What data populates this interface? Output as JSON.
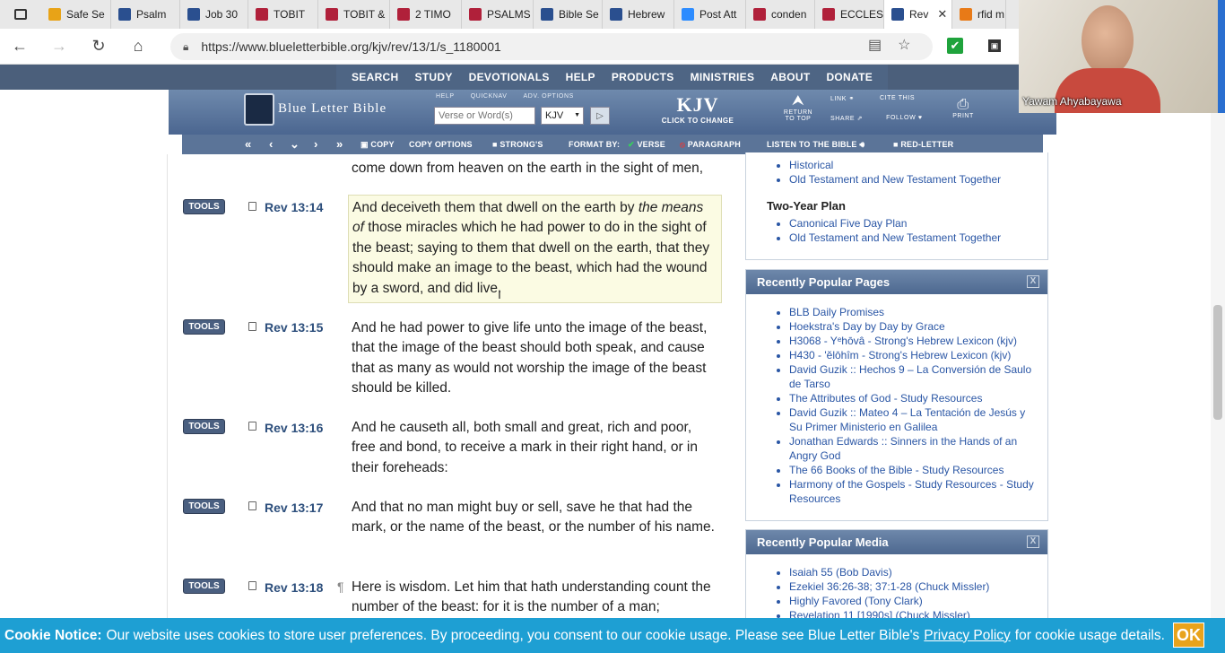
{
  "browser": {
    "tabs": [
      {
        "label": "Safe Se",
        "color": "#e8a317"
      },
      {
        "label": "Psalm",
        "color": "#2a4f8f"
      },
      {
        "label": "Job 30",
        "color": "#2a4f8f"
      },
      {
        "label": "TOBIT",
        "color": "#b0203a"
      },
      {
        "label": "TOBIT &",
        "color": "#b0203a"
      },
      {
        "label": "2 TIMO",
        "color": "#b0203a"
      },
      {
        "label": "PSALMS",
        "color": "#b0203a"
      },
      {
        "label": "Bible Se",
        "color": "#2a4f8f"
      },
      {
        "label": "Hebrew",
        "color": "#2a4f8f"
      },
      {
        "label": "Post Att",
        "color": "#2d8cff"
      },
      {
        "label": "conden",
        "color": "#b0203a"
      },
      {
        "label": "ECCLES",
        "color": "#b0203a"
      },
      {
        "label": "Rev",
        "color": "#2a4f8f"
      },
      {
        "label": "rfid m",
        "color": "#e87a17"
      }
    ],
    "active_tab_close": "✕",
    "url": "https://www.blueletterbible.org/kjv/rev/13/1/s_1180001",
    "ext_check": "✔",
    "ext_other": "▣"
  },
  "topnav": [
    "SEARCH",
    "STUDY",
    "DEVOTIONALS",
    "HELP",
    "PRODUCTS",
    "MINISTRIES",
    "ABOUT",
    "DONATE"
  ],
  "header": {
    "logo_text": "Blue Letter Bible",
    "labels": [
      "HELP",
      "QUICKNAV",
      "ADV. OPTIONS"
    ],
    "search_placeholder": "Verse or Word(s)",
    "version": "KJV",
    "version_big": "KJV",
    "version_sub": "CLICK TO CHANGE",
    "return_top": "RETURN TO TOP",
    "link": "LINK",
    "share": "SHARE",
    "cite_this": "CITE THIS",
    "follow": "FOLLOW",
    "print": "PRINT"
  },
  "subbar": {
    "copy": "COPY",
    "copy_options": "COPY OPTIONS",
    "strongs": "STRONG'S",
    "format_by": "FORMAT BY:",
    "verse": "VERSE",
    "paragraph": "PARAGRAPH",
    "listen": "LISTEN TO THE BIBLE",
    "red_letter": "RED-LETTER"
  },
  "content": {
    "tools_label": "TOOLS",
    "partial_top": "come down from heaven on the earth in the sight of men,",
    "verses": [
      {
        "ref": "Rev 13:14",
        "pre": "And deceiveth them that dwell on the earth by ",
        "italic": "the means of",
        "post": " those miracles which he had power to do in the sight of the beast; saying to them that dwell on the earth, that they should make an image to the beast, which had the wound by a sword, and did live."
      },
      {
        "ref": "Rev 13:15",
        "text": "And he had power to give life unto the image of the beast, that the image of the beast should both speak, and cause that as many as would not worship the image of the beast should be killed."
      },
      {
        "ref": "Rev 13:16",
        "text": "And he causeth all, both small and great, rich and poor, free and bond, to receive a mark in their right hand, or in their foreheads:"
      },
      {
        "ref": "Rev 13:17",
        "text": "And that no man might buy or sell, save he that had the mark, or the name of the beast, or the number of his name."
      },
      {
        "ref": "Rev 13:18",
        "para": "¶",
        "text": "Here is wisdom. Let him that hath understanding count the number of the beast: for it is the number of a man;"
      }
    ]
  },
  "sidebar": {
    "plan_top": [
      "Historical",
      "Old Testament and New Testament Together"
    ],
    "two_year_title": "Two-Year Plan",
    "two_year": [
      "Canonical Five Day Plan",
      "Old Testament and New Testament Together"
    ],
    "popular_pages_title": "Recently Popular Pages",
    "popular_pages": [
      "BLB Daily Promises",
      "Hoekstra's Day by Day by Grace",
      "H3068 - Yᵉhōvâ - Strong's Hebrew Lexicon (kjv)",
      "H430 - 'ĕlōhîm - Strong's Hebrew Lexicon (kjv)",
      "David Guzik :: Hechos 9 – La Conversión de Saulo de Tarso",
      "The Attributes of God - Study Resources",
      "David Guzik :: Mateo 4 – La Tentación de Jesús y Su Primer Ministerio en Galilea",
      "Jonathan Edwards :: Sinners in the Hands of an Angry God",
      "The 66 Books of the Bible - Study Resources",
      "Harmony of the Gospels - Study Resources - Study Resources"
    ],
    "popular_media_title": "Recently Popular Media",
    "popular_media": [
      "Isaiah 55 (Bob Davis)",
      "Ezekiel 36:26-38; 37:1-28 (Chuck Missler)",
      "Highly Favored (Tony Clark)",
      "Revelation 11 [1990s] (Chuck Missler)"
    ],
    "close": "X"
  },
  "webcam": {
    "name": "Yawam Ahyabayawa"
  },
  "cookie": {
    "bold": "Cookie Notice:",
    "text1": "Our website uses cookies to store user preferences. By proceeding, you consent to our cookie usage. Please see Blue Letter Bible's",
    "link": "Privacy Policy",
    "text2": "for cookie usage details.",
    "ok": "OK"
  }
}
